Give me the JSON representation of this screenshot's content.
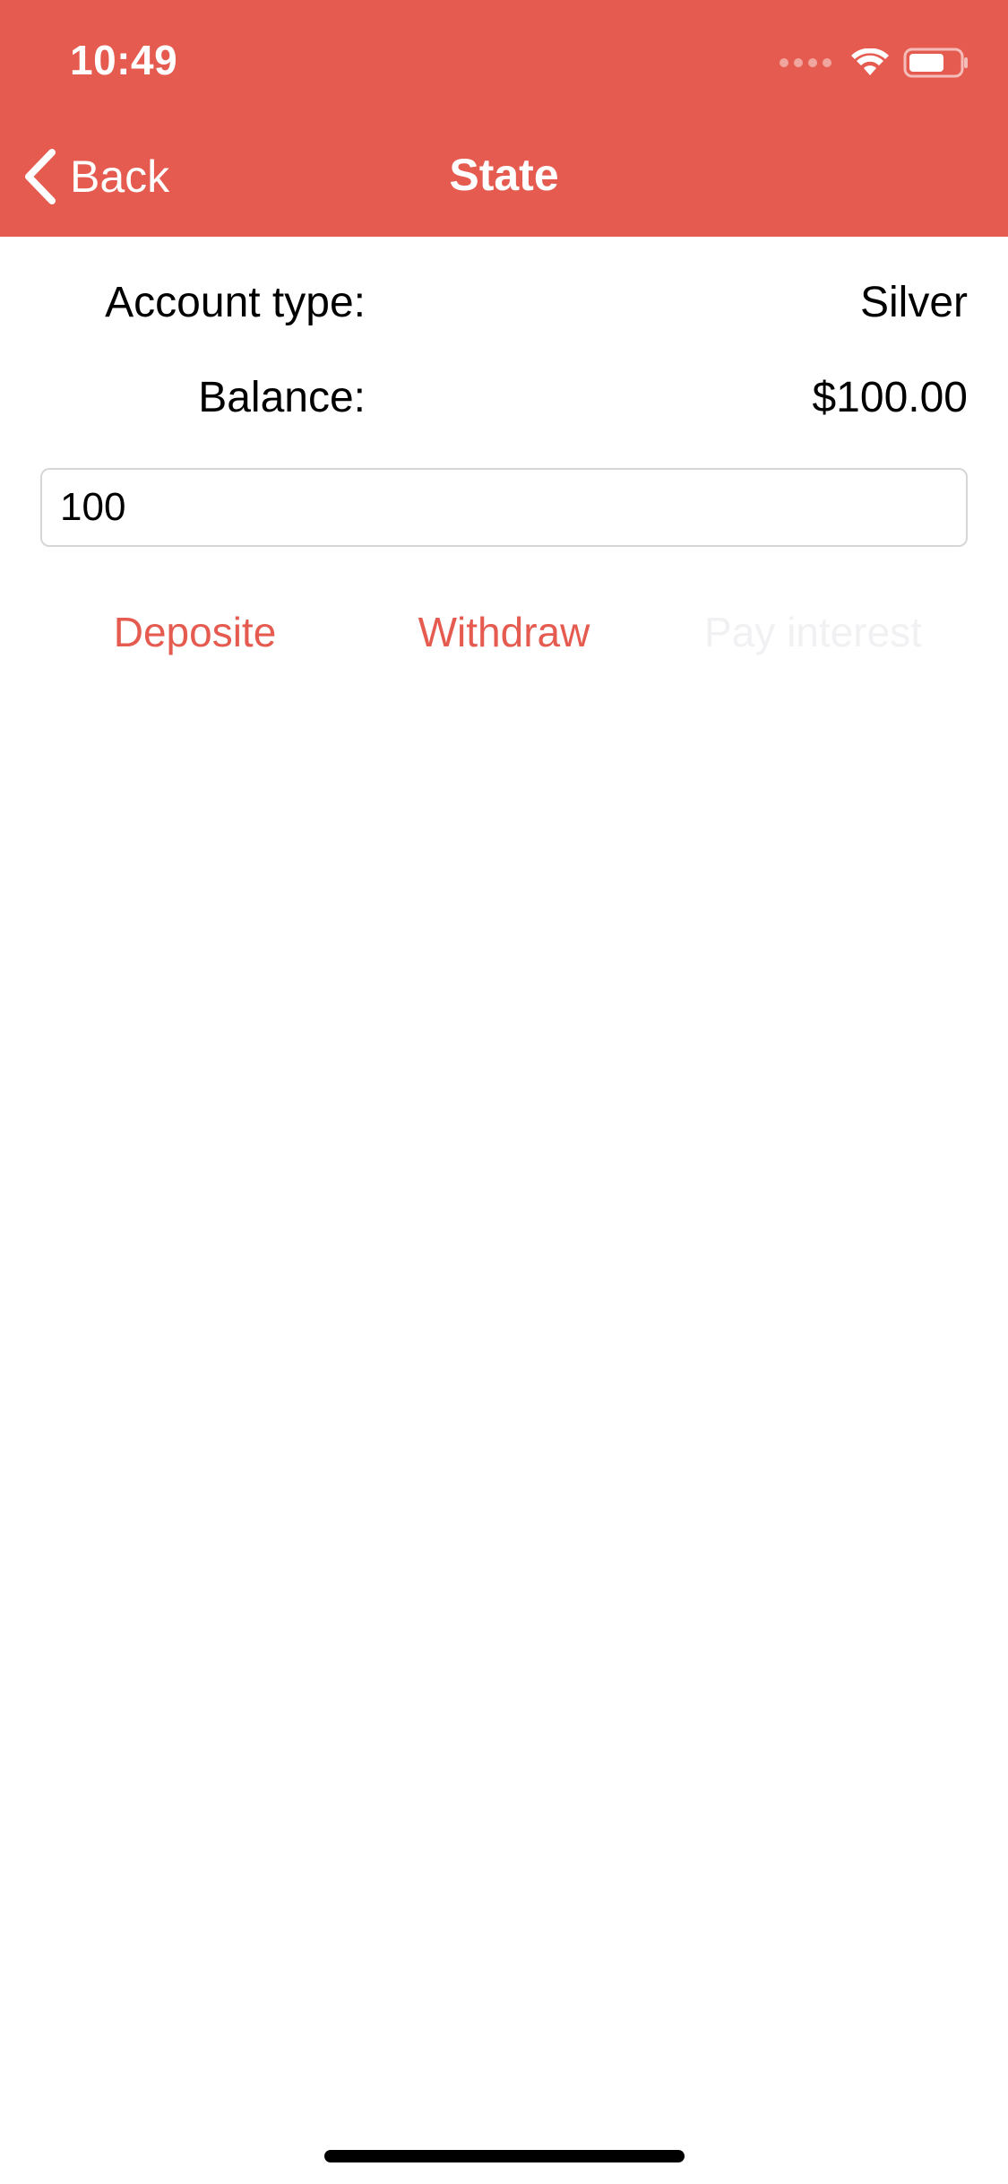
{
  "status_bar": {
    "time": "10:49",
    "icons": [
      "cellular-signal-icon",
      "wifi-icon",
      "battery-icon"
    ]
  },
  "nav_bar": {
    "back_label": "Back",
    "title": "State"
  },
  "account": {
    "type_label": "Account type:",
    "type_value": "Silver",
    "balance_label": "Balance:",
    "balance_value": "$100.00"
  },
  "amount_input": {
    "value": "100"
  },
  "actions": {
    "deposit_label": "Deposite",
    "withdraw_label": "Withdraw",
    "pay_interest_label": "Pay interest"
  },
  "colors": {
    "accent": "#e55b50",
    "disabled": "#f1f1f3",
    "text": "#000000",
    "background": "#ffffff"
  }
}
